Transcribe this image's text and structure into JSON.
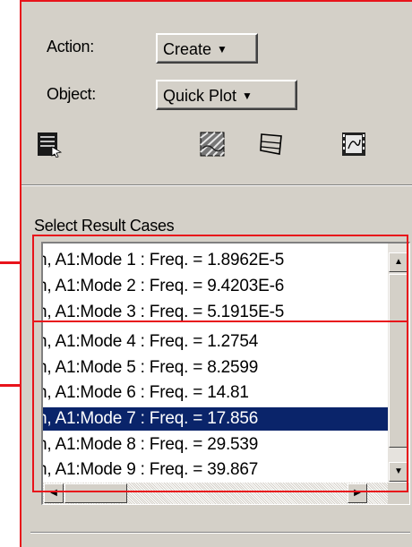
{
  "form": {
    "action_label": "Action:",
    "action_value": "Create",
    "object_label": "Object:",
    "object_value": "Quick Plot"
  },
  "toolbar": {
    "icons": [
      "select-results-icon",
      "fringe-plot-icon",
      "deformation-plot-icon",
      "animation-icon"
    ]
  },
  "result_cases": {
    "title": "Select Result Cases",
    "items": [
      "h, A1:Mode 1 : Freq. = 1.8962E-5",
      "h, A1:Mode 2 : Freq. = 9.4203E-6",
      "h, A1:Mode 3 : Freq. = 5.1915E-5",
      "h, A1:Mode 4 : Freq. = 1.2754",
      "h, A1:Mode 5 : Freq. = 8.2599",
      "h, A1:Mode 6 : Freq. = 14.81",
      "h, A1:Mode 7 : Freq. = 17.856",
      "h, A1:Mode 8 : Freq. = 29.539",
      "h, A1:Mode 9 : Freq. = 39.867"
    ],
    "selected_index": 6
  },
  "colors": {
    "annotation": "#e8131b",
    "selection": "#0a246a",
    "panel": "#d4d0c8"
  }
}
